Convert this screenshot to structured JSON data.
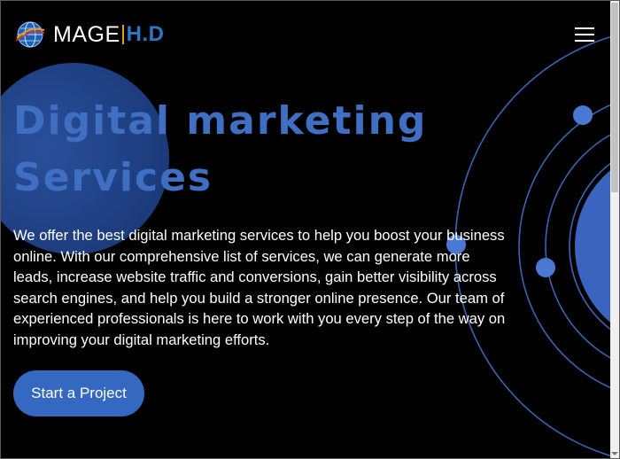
{
  "header": {
    "logo": {
      "wordmark_left": "MAGE",
      "wordmark_right": "H.D",
      "globe_icon": "globe-icon",
      "colors": {
        "wordmark_left": "#ffffff",
        "separator": "#e8962e",
        "wordmark_right": "#2f76c9"
      }
    },
    "menu_icon": "hamburger-menu-icon"
  },
  "hero": {
    "headline_line1": "Digital marketing",
    "headline_line2": "Services",
    "description": "We offer the best digital marketing services to help you boost your business online. With our comprehensive list of services, we can generate more leads, increase website traffic and conversions, gain better visibility across search engines, and help you build a stronger online presence. Our team of experienced professionals is here to work with you every step of the way on improving your digital marketing efforts.",
    "cta_label": "Start a Project"
  },
  "colors": {
    "background": "#000000",
    "accent": "#3f6fc3",
    "button": "#3569c1",
    "decoration_orbit": "#4a79d4",
    "text": "#ffffff"
  }
}
